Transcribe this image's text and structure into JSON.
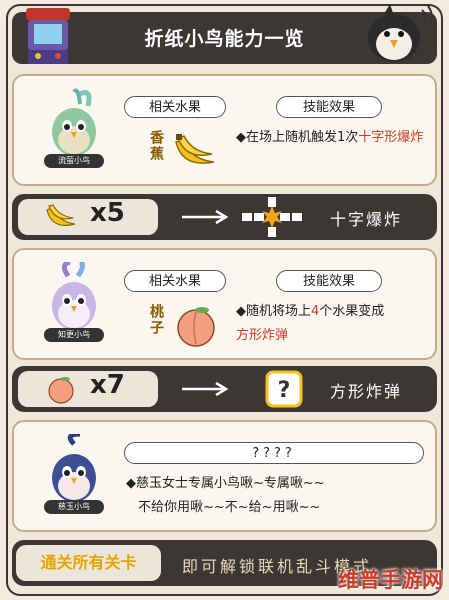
{
  "header": {
    "title": "折纸小鸟能力一览"
  },
  "cards": [
    {
      "bird_name": "流萤小鸟",
      "fruit_header": "相关水果",
      "skill_header": "技能效果",
      "fruit_label": "香蕉",
      "effect_prefix": "◆在场上随机触发1次",
      "effect_highlight": "十字形爆炸",
      "effect_suffix": ""
    },
    {
      "bird_name": "知更小鸟",
      "fruit_header": "相关水果",
      "skill_header": "技能效果",
      "fruit_label": "桃子",
      "effect_prefix": "◆随机将场上",
      "effect_number": "4",
      "effect_mid": "个水果变成",
      "effect_highlight": "方形炸弹"
    },
    {
      "bird_name": "慈玉小鸟",
      "unknown_header": "????",
      "effect_line1": "◆慈玉女士专属小鸟啾~专属啾~~",
      "effect_line2": "不给你用啾~~不~给~用啾~~"
    }
  ],
  "bars": [
    {
      "multiplier": "x5",
      "result": "十字爆炸"
    },
    {
      "multiplier": "x7",
      "result": "方形炸弹"
    }
  ],
  "footer": {
    "left": "通关所有关卡",
    "right": "即可解锁联机乱斗模式"
  },
  "watermark": "维普手游网",
  "colors": {
    "dark": "#3c3735",
    "accent_red": "#d33a1f",
    "card_border": "#c9a983",
    "banana": "#f6c21a",
    "peach": "#f2a07d"
  }
}
